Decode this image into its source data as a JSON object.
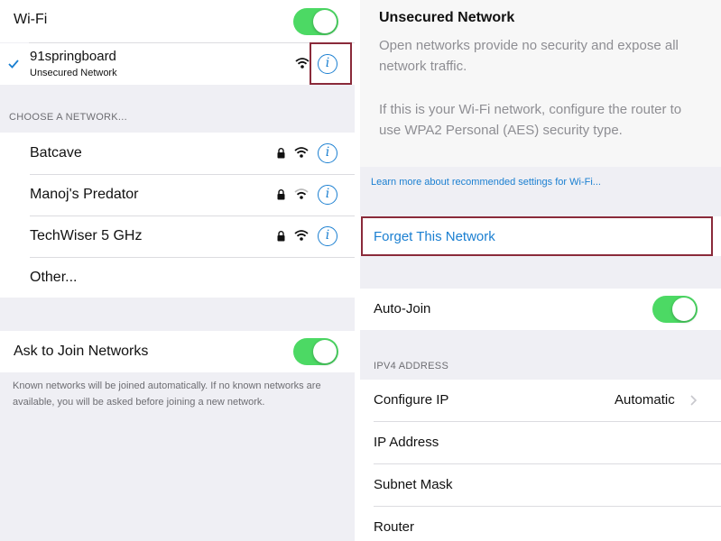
{
  "left": {
    "wifi_label": "Wi-Fi",
    "connected": {
      "name": "91springboard",
      "status": "Unsecured Network"
    },
    "choose_header": "CHOOSE A NETWORK...",
    "networks": [
      {
        "name": "Batcave",
        "locked": true
      },
      {
        "name": "Manoj's Predator",
        "locked": true
      },
      {
        "name": "TechWiser 5 GHz",
        "locked": true
      }
    ],
    "other_label": "Other...",
    "ask_label": "Ask to Join Networks",
    "ask_footnote": "Known networks will be joined automatically. If no known networks are available, you will be asked before joining a new network."
  },
  "right": {
    "title": "Unsecured Network",
    "desc1": "Open networks provide no security and expose all network traffic.",
    "desc2": "If this is your Wi-Fi network, configure the router to use WPA2 Personal (AES) security type.",
    "learn_more": "Learn more about recommended settings for Wi-Fi...",
    "forget": "Forget This Network",
    "auto_join": "Auto-Join",
    "ipv4_header": "IPV4 ADDRESS",
    "configure_ip": "Configure IP",
    "configure_ip_value": "Automatic",
    "ip_address": "IP Address",
    "subnet_mask": "Subnet Mask",
    "router": "Router"
  },
  "colors": {
    "accent": "#1a7fd1",
    "toggle_on": "#4cd964",
    "highlight": "#8a2a3a",
    "background": "#efeff4"
  }
}
